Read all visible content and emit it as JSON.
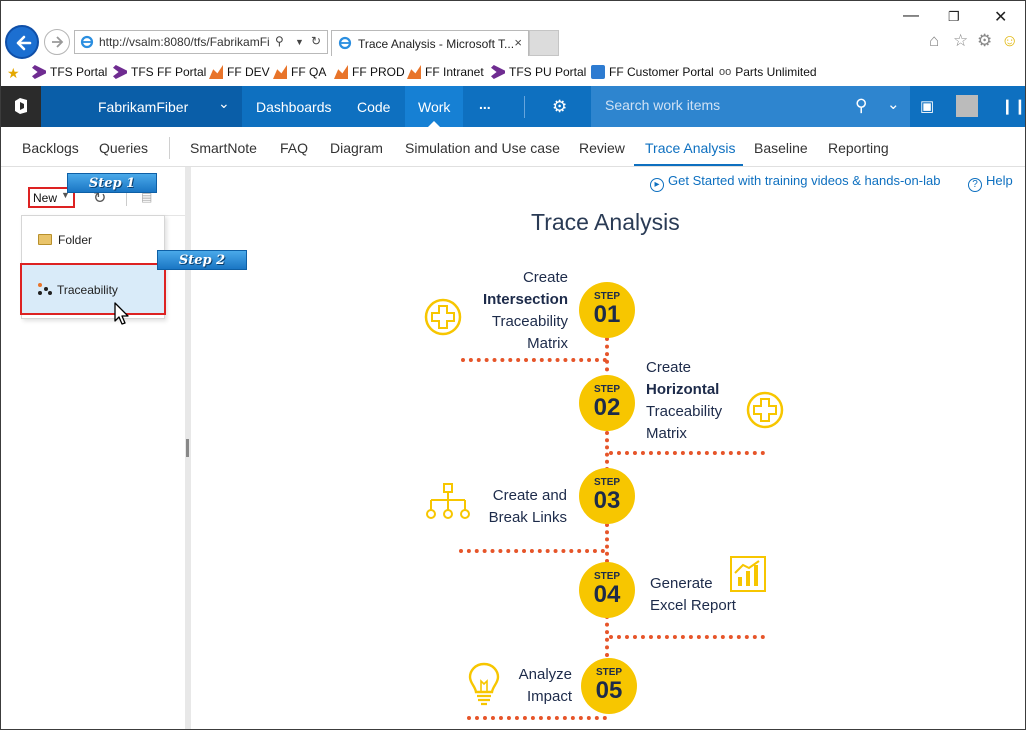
{
  "browser": {
    "url": "http://vsalm:8080/tfs/FabrikamFi",
    "tab_title": "Trace Analysis - Microsoft T...",
    "favorites": [
      "TFS Portal",
      "TFS FF Portal",
      "FF DEV",
      "FF QA",
      "FF PROD",
      "FF Intranet",
      "TFS PU Portal",
      "FF Customer Portal",
      "Parts Unlimited"
    ]
  },
  "topbar": {
    "project": "FabrikamFiber",
    "hubs": [
      "Dashboards",
      "Code",
      "Work",
      "..."
    ],
    "active_hub": "Work",
    "search_placeholder": "Search work items"
  },
  "subnav": {
    "items": [
      "Backlogs",
      "Queries",
      "SmartNote",
      "FAQ",
      "Diagram",
      "Simulation and Use case",
      "Review",
      "Trace Analysis",
      "Baseline",
      "Reporting"
    ],
    "active": "Trace Analysis"
  },
  "left": {
    "new_label": "New",
    "menu": [
      "Folder",
      "Traceability"
    ],
    "callouts": [
      "Step 1",
      "Step 2"
    ]
  },
  "content": {
    "help_link": "Get Started with training videos & hands-on-lab",
    "help": "Help",
    "title": "Trace Analysis",
    "step_word": "STEP",
    "steps": [
      {
        "num": "01",
        "lines": [
          "Create",
          "Intersection",
          "Traceability",
          "Matrix"
        ],
        "bold": "Intersection",
        "icon": "plus-circle-icon"
      },
      {
        "num": "02",
        "lines": [
          "Create",
          "Horizontal",
          "Traceability",
          "Matrix"
        ],
        "bold": "Horizontal",
        "icon": "plus-circle-icon"
      },
      {
        "num": "03",
        "lines": [
          "Create and",
          "Break Links"
        ],
        "icon": "hierarchy-icon"
      },
      {
        "num": "04",
        "lines": [
          "Generate",
          "Excel Report"
        ],
        "icon": "bar-chart-icon"
      },
      {
        "num": "05",
        "lines": [
          "Analyze",
          "Impact"
        ],
        "icon": "lightbulb-icon"
      }
    ]
  },
  "colors": {
    "accent": "#0e70c0",
    "step_yellow": "#f7c600",
    "dotted_line": "#e6552a",
    "highlight_border": "#dd2222"
  }
}
